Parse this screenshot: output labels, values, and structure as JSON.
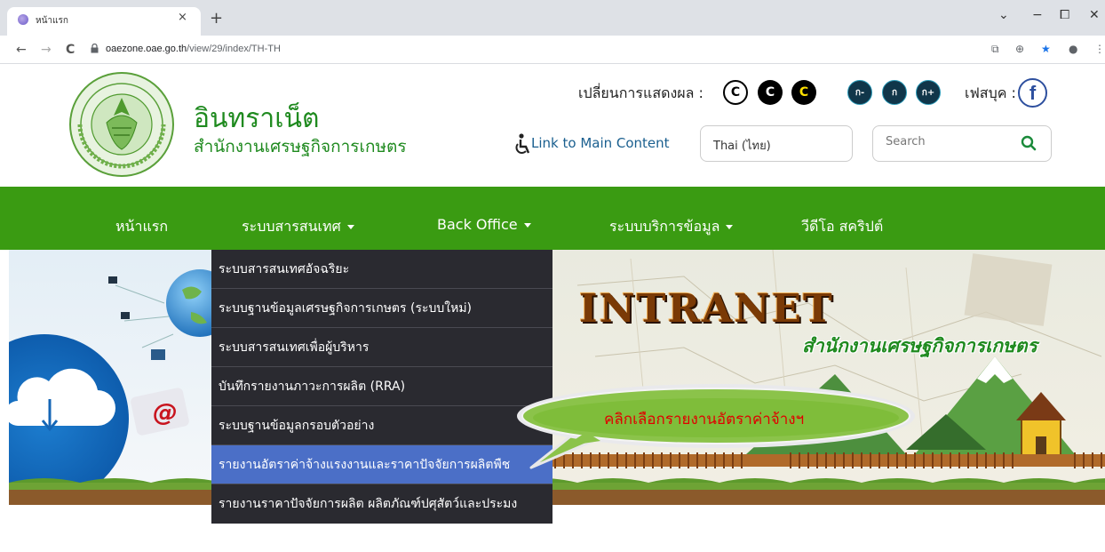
{
  "browser": {
    "tab_title": "หน้าแรก",
    "tab_close": "×",
    "new_tab": "+",
    "url_host": "oaezone.oae.go.th",
    "url_path": "/view/29/index/TH-TH",
    "back": "←",
    "forward": "→",
    "reload": "C",
    "minimize": "−",
    "restore": "⧠",
    "close": "✕",
    "tab_menu": "⌄"
  },
  "header": {
    "title": "อินทราเน็ต",
    "subtitle": "สำนักงานเศรษฐกิจการเกษตร",
    "display_label": "เปลี่ยนการแสดงผล :",
    "contrast_buttons": [
      "C",
      "C",
      "C"
    ],
    "font_buttons": [
      "ก-",
      "ก",
      "ก+"
    ],
    "facebook_label": "เฟสบุค :",
    "facebook_glyph": "f",
    "link_main": "Link to Main Content",
    "language_value": "Thai (ไทย)",
    "search_placeholder": "Search"
  },
  "nav": {
    "items": [
      {
        "label": "หน้าแรก"
      },
      {
        "label": "ระบบสารสนเทศ"
      },
      {
        "label": "Back Office"
      },
      {
        "label": "ระบบบริการข้อมูล"
      },
      {
        "label": "วีดีโอ สคริปต์"
      }
    ]
  },
  "dropdown": {
    "items": [
      {
        "label": "ระบบสารสนเทศอัจฉริยะ"
      },
      {
        "label": "ระบบฐานข้อมูลเศรษฐกิจการเกษตร (ระบบใหม่)"
      },
      {
        "label": "ระบบสารสนเทศเพื่อผู้บริหาร"
      },
      {
        "label": "บันทึกรายงานภาวะการผลิต (RRA)"
      },
      {
        "label": "ระบบฐานข้อมูลกรอบตัวอย่าง"
      },
      {
        "label": "รายงานอัตราค่าจ้างแรงงานและราคาปัจจัยการผลิตพืช"
      },
      {
        "label": "รายงานราคาปัจจัยการผลิต ผลิตภัณฑ์ปศุสัตว์และประมง"
      }
    ]
  },
  "banner": {
    "headline": "INTRANET",
    "org": "สำนักงานเศรษฐกิจการเกษตร",
    "at_glyph": "@"
  },
  "callout": {
    "text": "คลิกเลือกรายงานอัตราค่าจ้างฯ"
  },
  "colors": {
    "nav_green": "#3a9b12",
    "dropdown_bg": "#2a2a30",
    "active_item": "#4b6fc7",
    "callout_fill": "#8bc34a",
    "callout_text": "#e00000"
  }
}
